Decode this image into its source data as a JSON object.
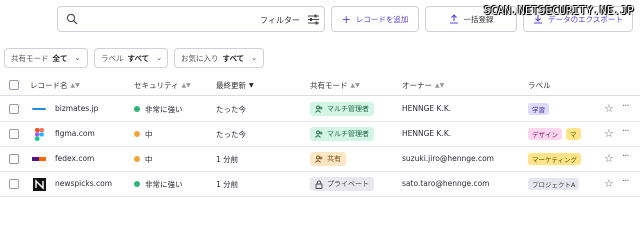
{
  "watermark": "SCAN.NETSECURITY.NE.JP",
  "toolbar": {
    "search_placeholder": "",
    "filter_label": "フィルター",
    "add_record_label": "レコードを追加",
    "bulk_register_label": "一括登録",
    "export_label": "データのエクスポート"
  },
  "filters": [
    {
      "key": "共有モード",
      "value": "全て"
    },
    {
      "key": "ラベル",
      "value": "すべて"
    },
    {
      "key": "お気に入り",
      "value": "すべて"
    }
  ],
  "columns": {
    "record_name": "レコード名",
    "security": "セキュリティ",
    "last_updated": "最終更新",
    "share_mode": "共有モード",
    "owner": "オーナー",
    "label": "ラベル"
  },
  "rows": [
    {
      "logo_icon": "bizmates-logo-icon",
      "name": "bizmates.jp",
      "security": "非常に強い",
      "security_color": "#2bb673",
      "updated": "たった今",
      "share_mode": "マルチ管理者",
      "share_kind": "multi",
      "owner": "HENNGE K.K.",
      "labels": [
        {
          "text": "学習",
          "bg": "#dcd9ff",
          "fg": "#3b3090"
        }
      ]
    },
    {
      "logo_icon": "figma-logo-icon",
      "name": "figma.com",
      "security": "中",
      "security_color": "#f2a33a",
      "updated": "たった今",
      "share_mode": "マルチ管理者",
      "share_kind": "multi",
      "owner": "HENNGE K.K.",
      "labels": [
        {
          "text": "デザイン",
          "bg": "#ffd6ef",
          "fg": "#8a1f5c"
        },
        {
          "text": "マ",
          "bg": "#ffe58a",
          "fg": "#6a5200"
        }
      ]
    },
    {
      "logo_icon": "fedex-logo-icon",
      "name": "fedex.com",
      "security": "中",
      "security_color": "#f2a33a",
      "updated": "1 分前",
      "share_mode": "共有",
      "share_kind": "shared",
      "owner": "suzuki.jiro@hennge.com",
      "labels": [
        {
          "text": "マーケティング",
          "bg": "#ffe58a",
          "fg": "#6a5200"
        }
      ]
    },
    {
      "logo_icon": "newspicks-logo-icon",
      "name": "newspicks.com",
      "security": "非常に強い",
      "security_color": "#2bb673",
      "updated": "1 分前",
      "share_mode": "プライベート",
      "share_kind": "private",
      "owner": "sato.taro@hennge.com",
      "labels": [
        {
          "text": "プロジェクトA",
          "bg": "#e6e6ee",
          "fg": "#444"
        }
      ]
    }
  ]
}
